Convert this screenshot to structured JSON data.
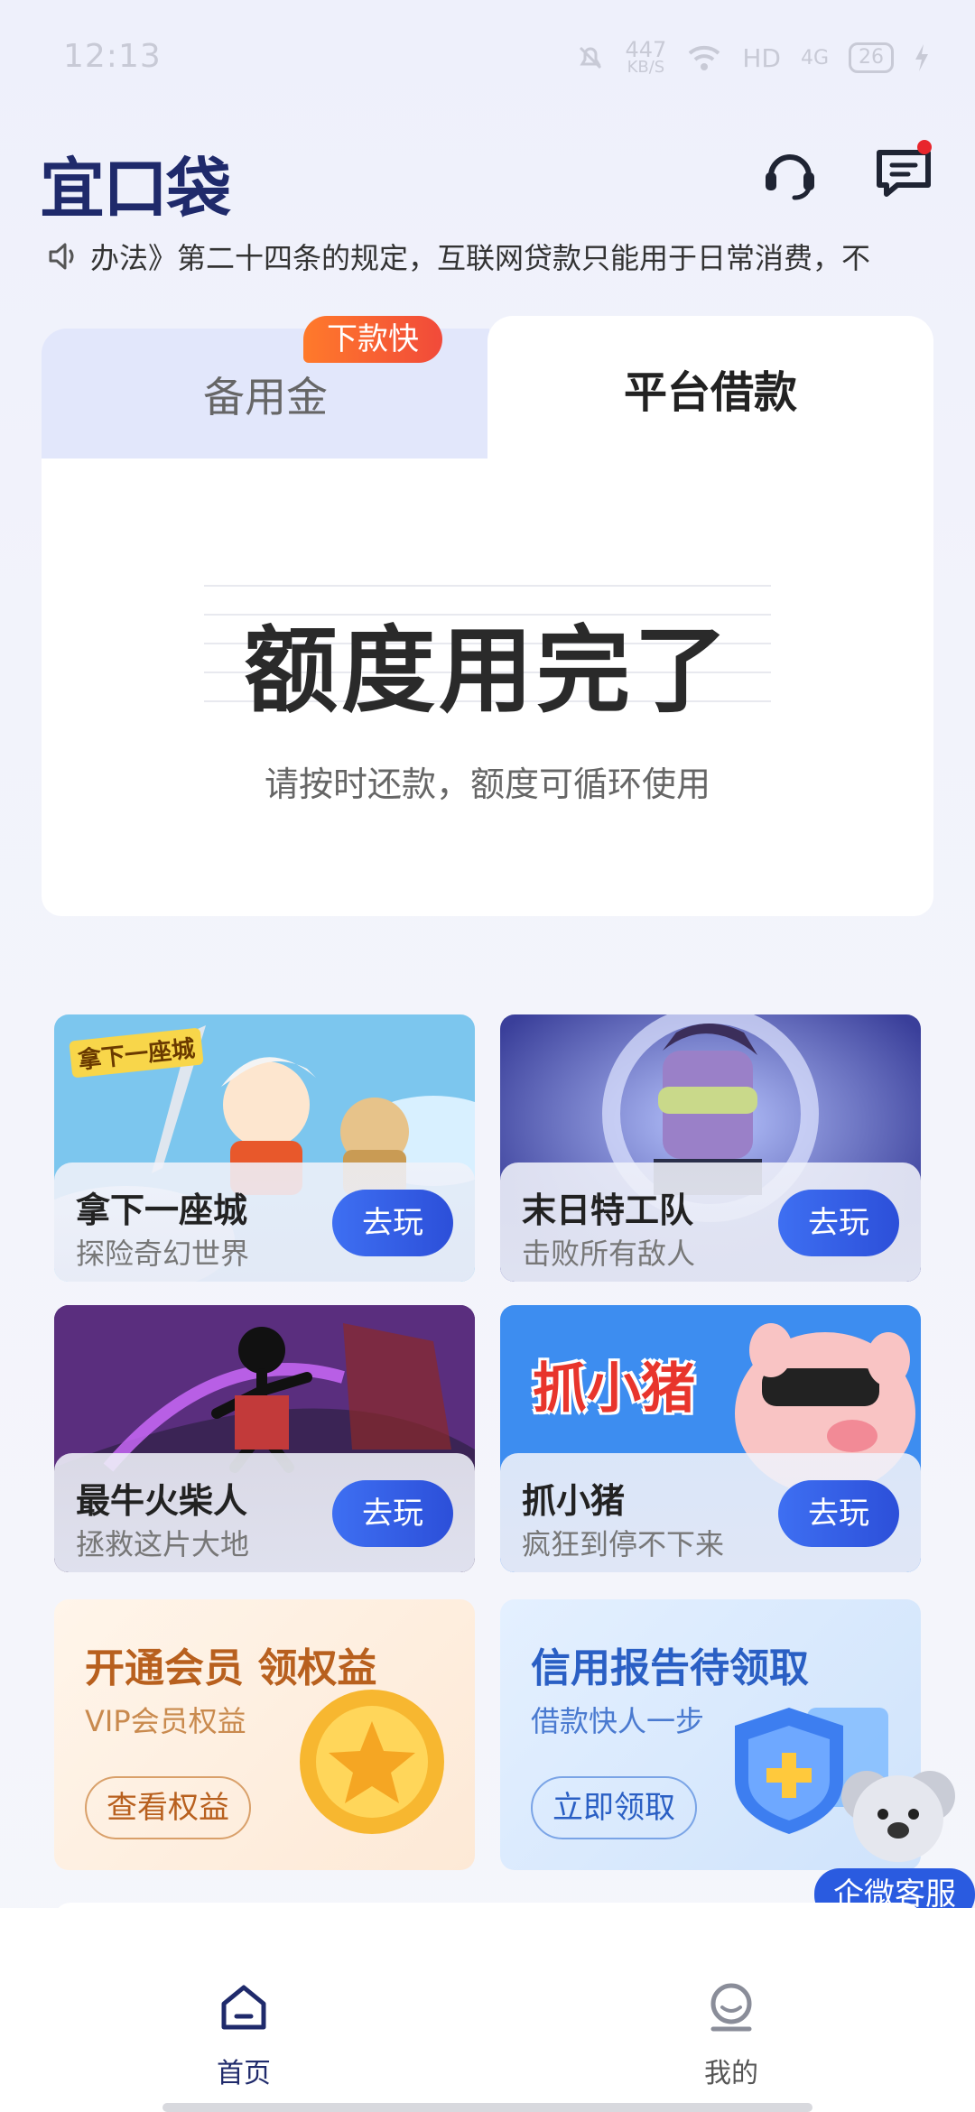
{
  "status_bar": {
    "time": "12:13",
    "net_speed_value": "447",
    "net_speed_unit": "KB/S",
    "hd_label": "HD",
    "signal_label": "4G",
    "battery": "26"
  },
  "header": {
    "logo_text": "宜口袋"
  },
  "notice": {
    "text": "办法》第二十四条的规定，互联网贷款只能用于日常消费，不"
  },
  "tabs": {
    "left_label": "备用金",
    "left_badge": "下款快",
    "right_label": "平台借款"
  },
  "quota": {
    "title": "额度用完了",
    "subtitle": "请按时还款，额度可循环使用"
  },
  "games": [
    {
      "title": "拿下一座城",
      "subtitle": "探险奇幻世界",
      "button": "去玩",
      "art_label": "拿下一座城"
    },
    {
      "title": "末日特工队",
      "subtitle": "击败所有敌人",
      "button": "去玩"
    },
    {
      "title": "最牛火柴人",
      "subtitle": "拯救这片大地",
      "button": "去玩"
    },
    {
      "title": "抓小猪",
      "subtitle": "疯狂到停不下来",
      "button": "去玩",
      "art_label": "抓小猪"
    }
  ],
  "promos": {
    "vip": {
      "title": "开通会员 领权益",
      "subtitle": "VIP会员权益",
      "button": "查看权益"
    },
    "credit": {
      "title": "信用报告待领取",
      "subtitle": "借款快人一步",
      "button": "立即领取"
    }
  },
  "service": {
    "label": "企微客服"
  },
  "bottom_nav": [
    {
      "label": "首页",
      "active": true
    },
    {
      "label": "我的",
      "active": false
    }
  ],
  "colors": {
    "brand_dark": "#1f2a6b",
    "primary_blue": "#2c4fd9",
    "badge_orange": "#f14a3a",
    "vip_text": "#b8601e",
    "credit_text": "#2a5fc4"
  }
}
